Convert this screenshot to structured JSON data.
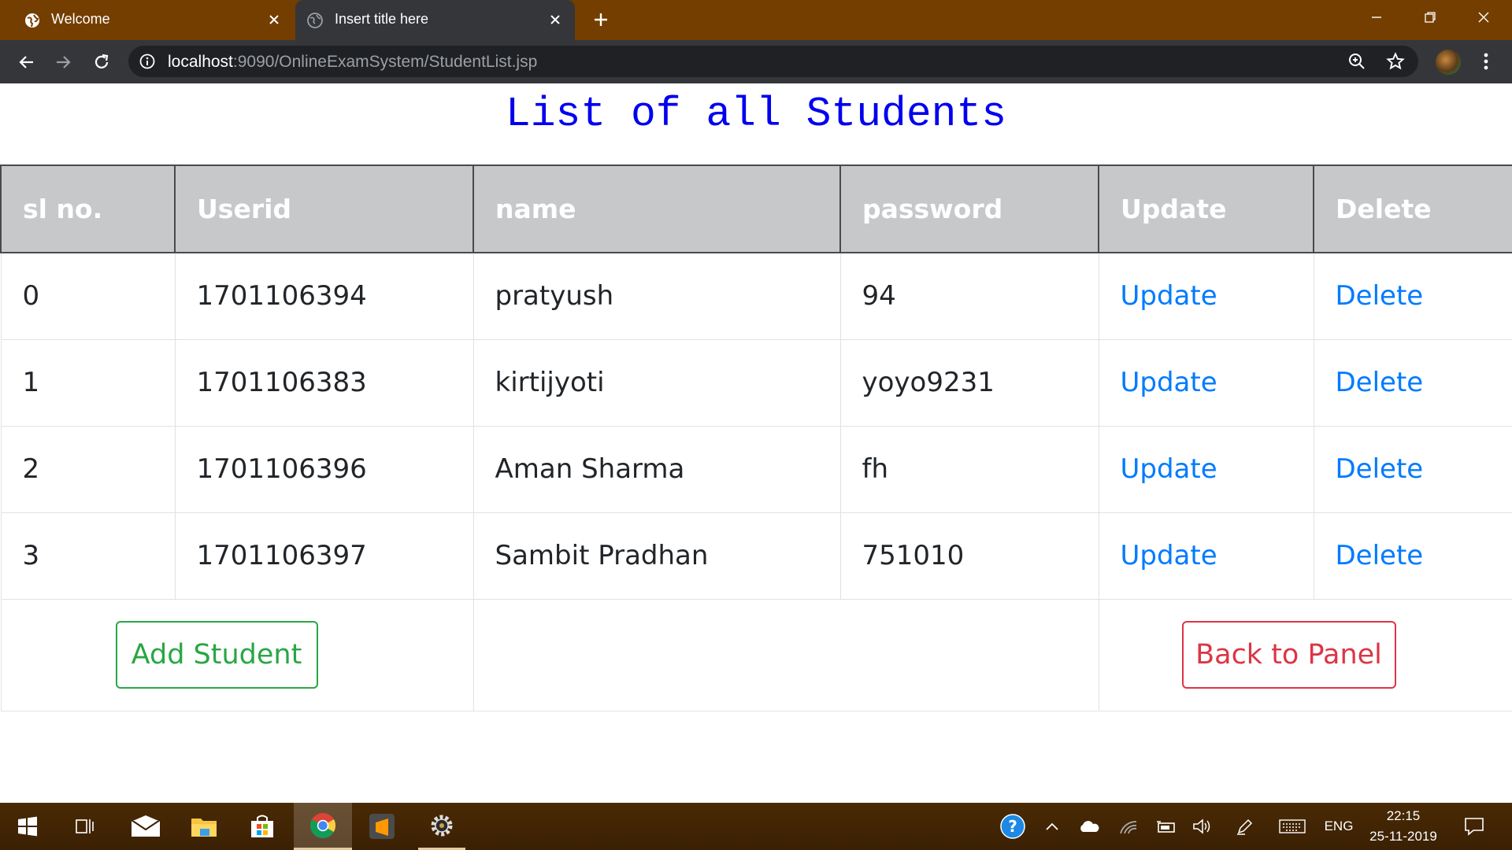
{
  "browser": {
    "tabs": [
      {
        "title": "Welcome"
      },
      {
        "title": "Insert title here"
      }
    ],
    "url": {
      "host": "localhost",
      "rest": ":9090/OnlineExamSystem/StudentList.jsp"
    }
  },
  "page": {
    "title": "List of all Students",
    "table": {
      "headers": [
        "sl no.",
        "Userid",
        "name",
        "password",
        "Update",
        "Delete"
      ],
      "rows": [
        {
          "sl": "0",
          "userid": "1701106394",
          "name": "pratyush",
          "password": "94",
          "update": "Update",
          "delete": "Delete"
        },
        {
          "sl": "1",
          "userid": "1701106383",
          "name": "kirtijyoti",
          "password": "yoyo9231",
          "update": "Update",
          "delete": "Delete"
        },
        {
          "sl": "2",
          "userid": "1701106396",
          "name": "Aman Sharma",
          "password": "fh",
          "update": "Update",
          "delete": "Delete"
        },
        {
          "sl": "3",
          "userid": "1701106397",
          "name": "Sambit Pradhan",
          "password": "751010",
          "update": "Update",
          "delete": "Delete"
        }
      ]
    },
    "buttons": {
      "add_student": "Add Student",
      "back_to_panel": "Back to Panel"
    }
  },
  "taskbar": {
    "language": "ENG",
    "time": "22:15",
    "date": "25-11-2019"
  }
}
